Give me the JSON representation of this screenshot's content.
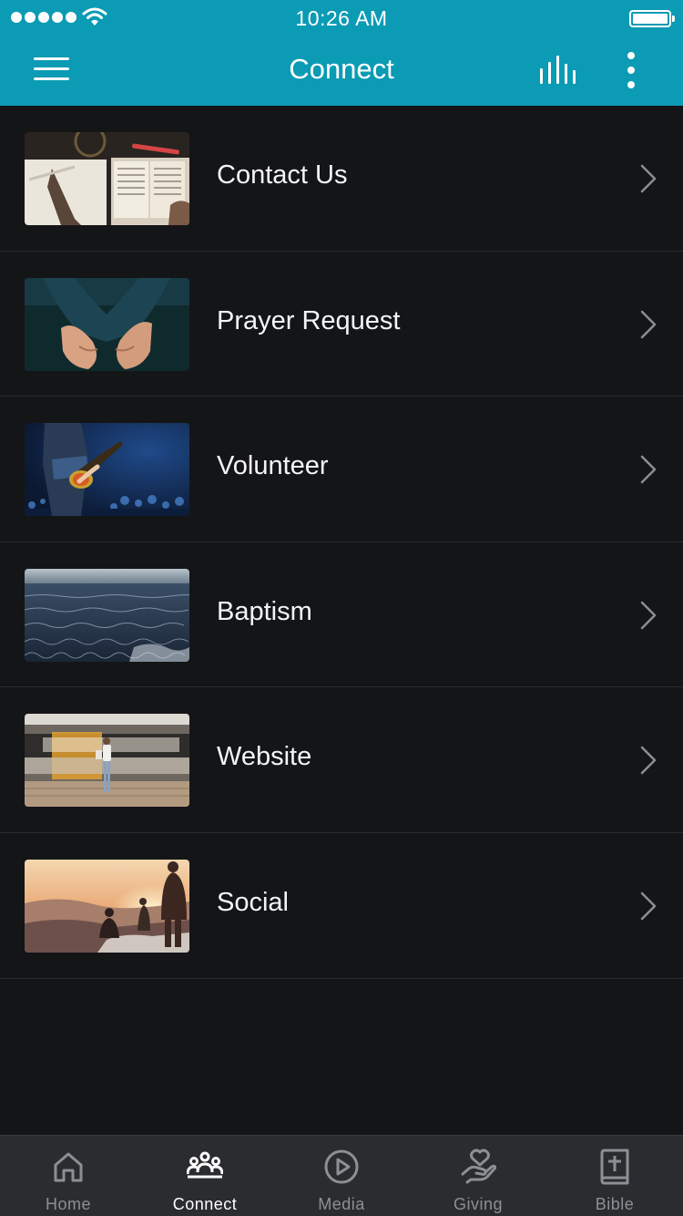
{
  "status_bar": {
    "time": "10:26 AM"
  },
  "nav": {
    "title": "Connect",
    "menu_icon": "hamburger-menu-icon",
    "audio_icon": "audio-bars-icon",
    "more_icon": "more-vertical-icon"
  },
  "colors": {
    "accent": "#0b9bb4",
    "background": "#141517",
    "tabbar": "#2b2c2f",
    "tab_inactive": "#8d8f94",
    "tab_active": "#ffffff"
  },
  "items": [
    {
      "label": "Contact Us",
      "image": "open-bible-notebook"
    },
    {
      "label": "Prayer Request",
      "image": "open-hands"
    },
    {
      "label": "Volunteer",
      "image": "guitarist-on-stage"
    },
    {
      "label": "Baptism",
      "image": "ocean-water"
    },
    {
      "label": "Website",
      "image": "woman-train-platform"
    },
    {
      "label": "Social",
      "image": "people-at-sunset"
    }
  ],
  "tabs": [
    {
      "label": "Home",
      "icon": "home-icon",
      "active": false
    },
    {
      "label": "Connect",
      "icon": "people-group-icon",
      "active": true
    },
    {
      "label": "Media",
      "icon": "play-circle-icon",
      "active": false
    },
    {
      "label": "Giving",
      "icon": "heart-hand-icon",
      "active": false
    },
    {
      "label": "Bible",
      "icon": "bible-cross-icon",
      "active": false
    }
  ]
}
